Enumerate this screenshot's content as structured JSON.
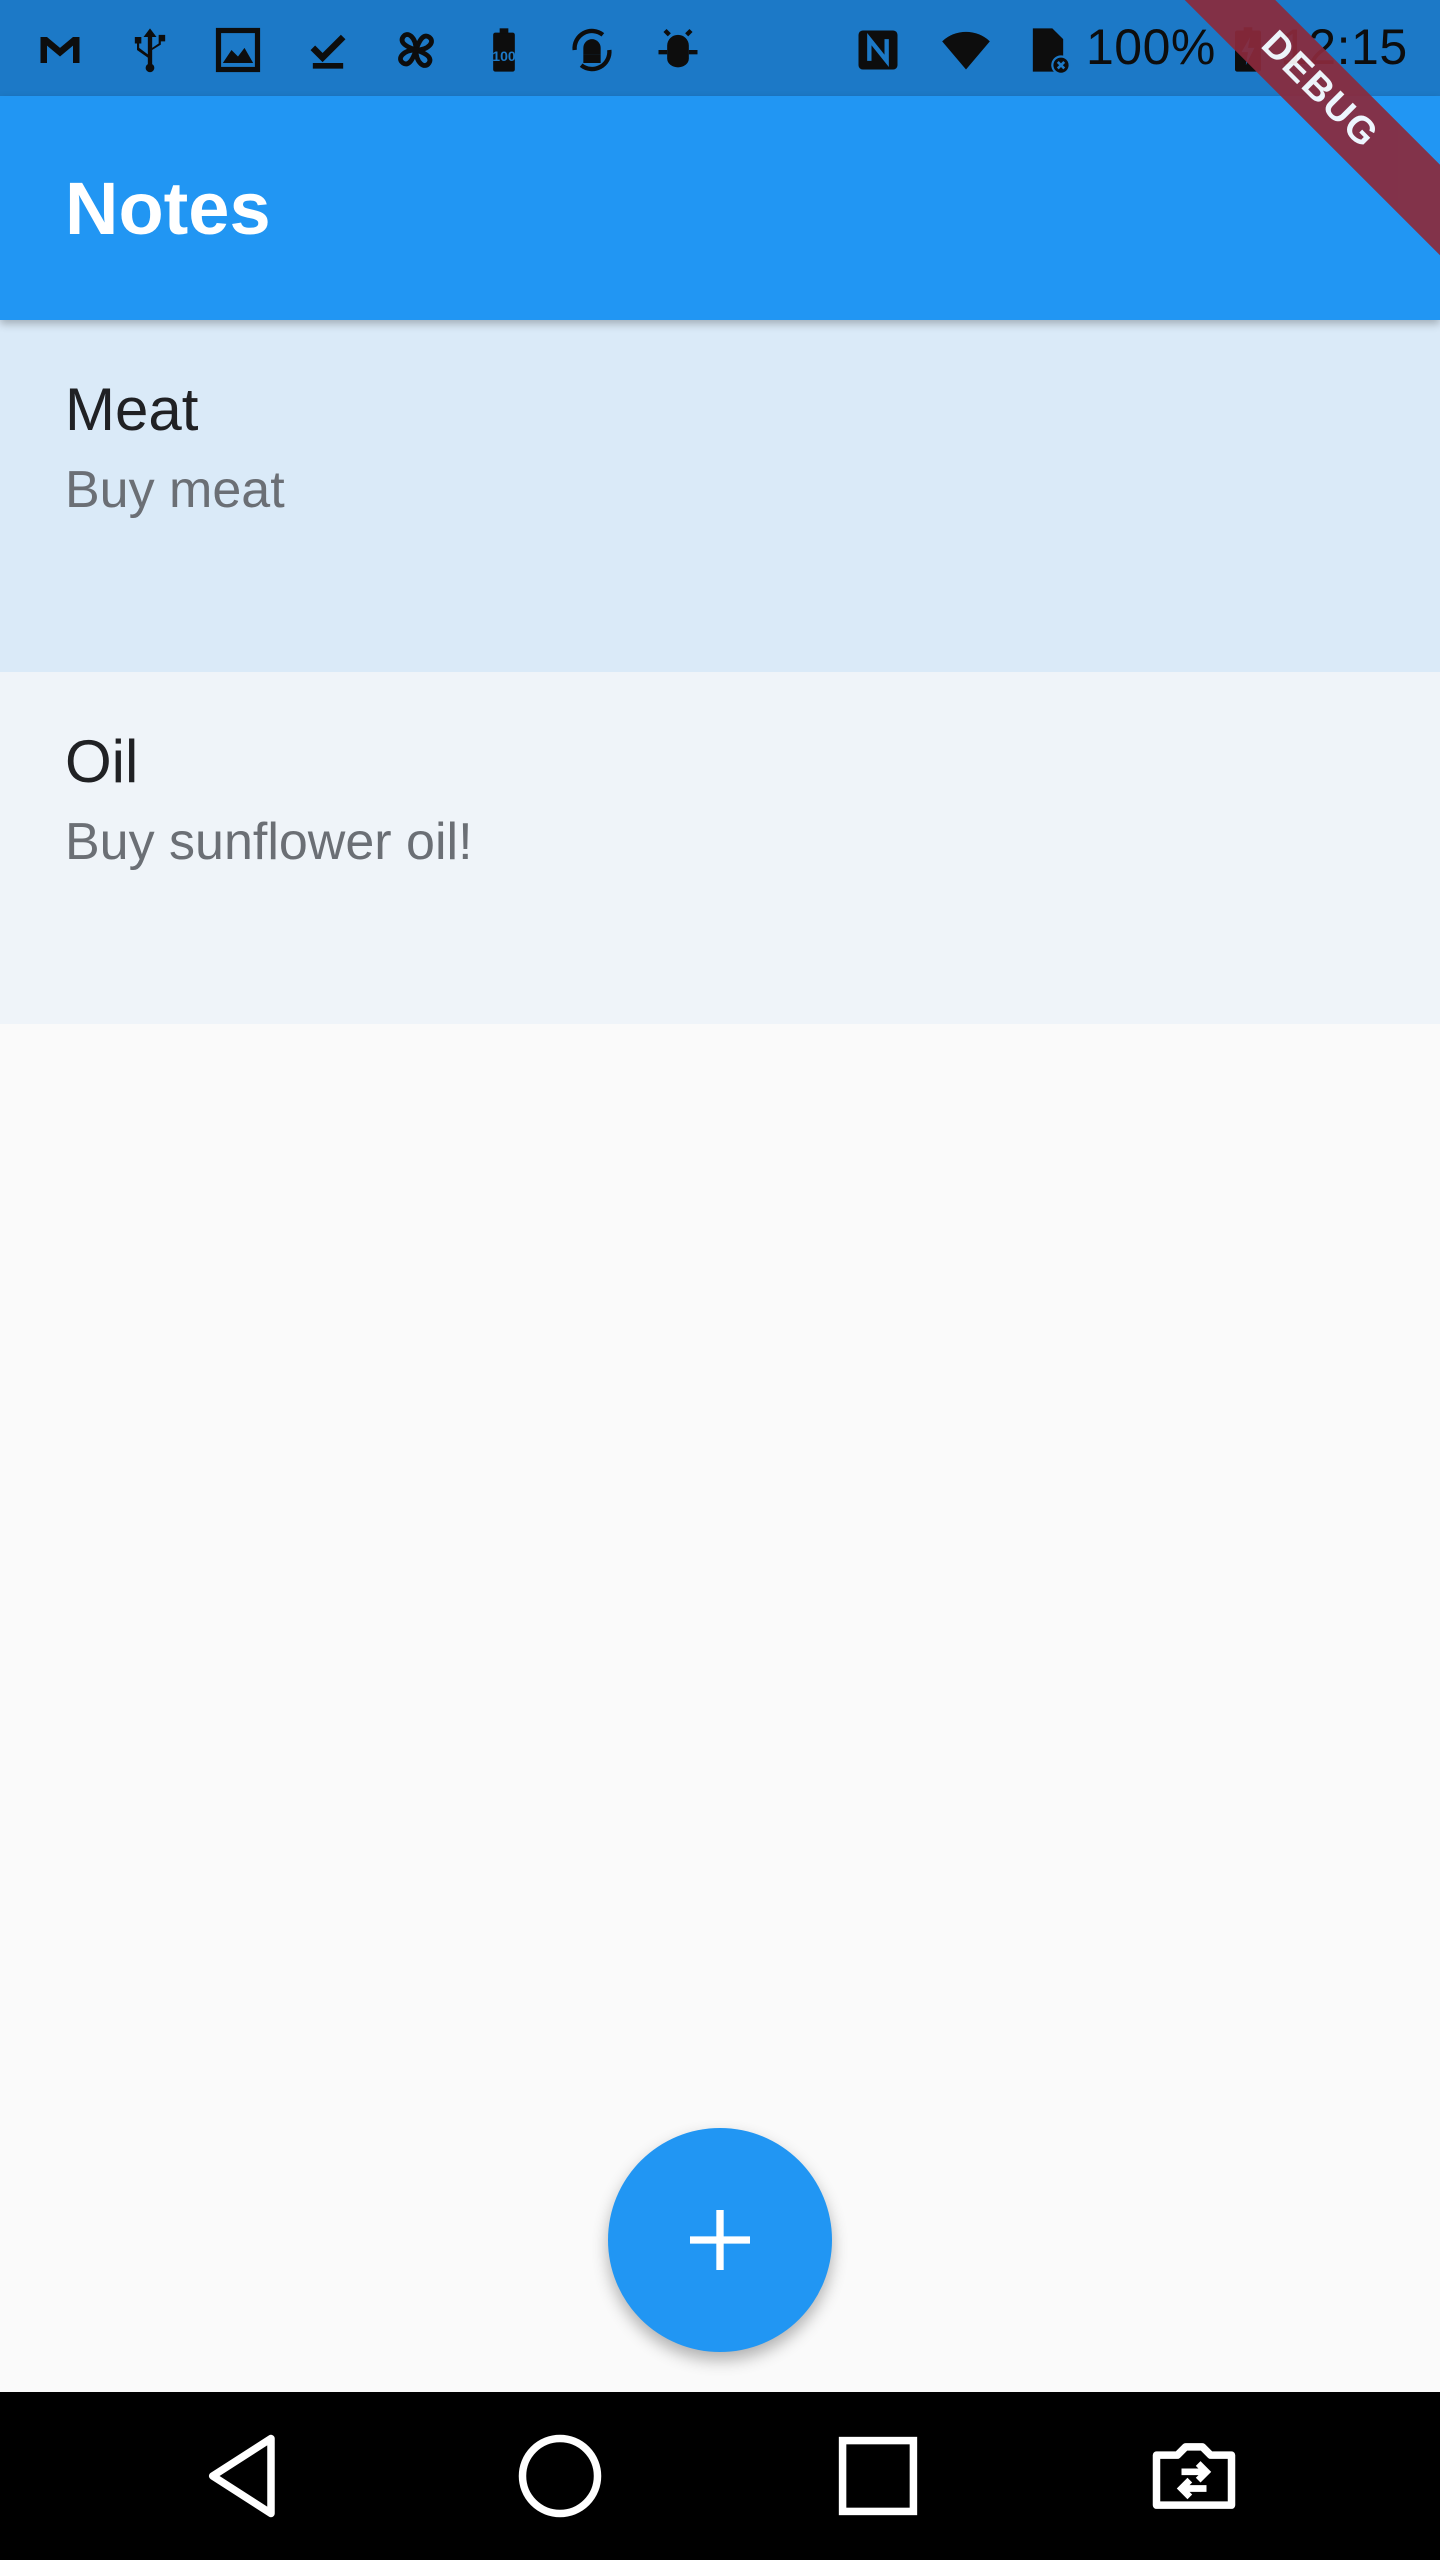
{
  "status_bar": {
    "icons": [
      "gmail-icon",
      "usb-icon",
      "image-icon",
      "download-done-icon",
      "pinwheel-icon",
      "battery-100-icon",
      "android-sync-icon",
      "bug-icon",
      "nfc-icon",
      "wifi-icon",
      "sim-no-service-icon",
      "battery-charging-icon"
    ],
    "battery": "100%",
    "time": "12:15"
  },
  "app_bar": {
    "title": "Notes"
  },
  "debug_banner": "DEBUG",
  "notes": [
    {
      "title": "Meat",
      "body": "Buy meat",
      "selected": true
    },
    {
      "title": "Oil",
      "body": "Buy sunflower oil!",
      "selected": false
    }
  ],
  "fab": {
    "icon": "add-icon"
  },
  "nav_bar": {
    "icons": [
      "back-icon",
      "home-icon",
      "recents-icon",
      "switch-app-icon"
    ]
  },
  "colors": {
    "primary": "#2196f3",
    "status_bar": "#1c79c7",
    "selected_row": "#daeaf8",
    "row": "#eff4f9",
    "background": "#fafafa",
    "debug": "#8b2a3c"
  }
}
